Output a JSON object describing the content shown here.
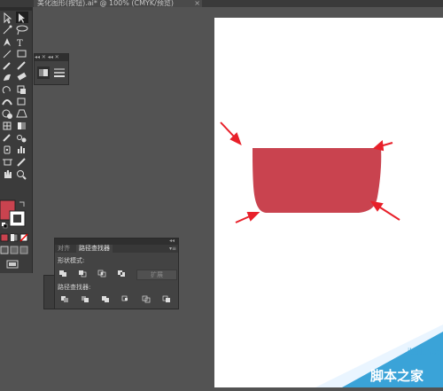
{
  "window": {
    "tab_title": "美化图形(按钮).ai* @ 100% (CMYK/预览)",
    "tab_close": "×"
  },
  "toolbar": {
    "tools": [
      "selection-tool",
      "direct-selection-tool",
      "magic-wand-tool",
      "lasso-tool",
      "pen-tool",
      "type-tool",
      "line-segment-tool",
      "rectangle-tool",
      "paintbrush-tool",
      "pencil-tool",
      "blob-brush-tool",
      "eraser-tool",
      "rotate-tool",
      "scale-tool",
      "width-tool",
      "free-transform-tool",
      "shape-builder-tool",
      "perspective-grid-tool",
      "mesh-tool",
      "gradient-tool",
      "eyedropper-tool",
      "blend-tool",
      "symbol-sprayer-tool",
      "column-graph-tool",
      "artboard-tool",
      "slice-tool",
      "hand-tool",
      "zoom-tool"
    ],
    "fill_color": "#c9434f",
    "stroke_color": "#ffffff"
  },
  "mini_panel": {
    "header": "◂◂ ✕ ◂◂ ✕"
  },
  "pathfinder": {
    "tabs": [
      "对齐",
      "路径查找器"
    ],
    "active_tab": "路径查找器",
    "shape_modes_label": "形状模式:",
    "pathfinders_label": "路径查找器:",
    "expand_label": "扩展",
    "collapse_glyph": "◂◂",
    "menu_glyph": "▾≡"
  },
  "canvas": {
    "artboard_color": "#ffffff",
    "shape_color": "#c9434f",
    "arrow_color": "#e8202a"
  },
  "watermark": {
    "domain_text": "jb51.net",
    "brand_text": "脚本之家",
    "color": "#3aa3d8"
  }
}
